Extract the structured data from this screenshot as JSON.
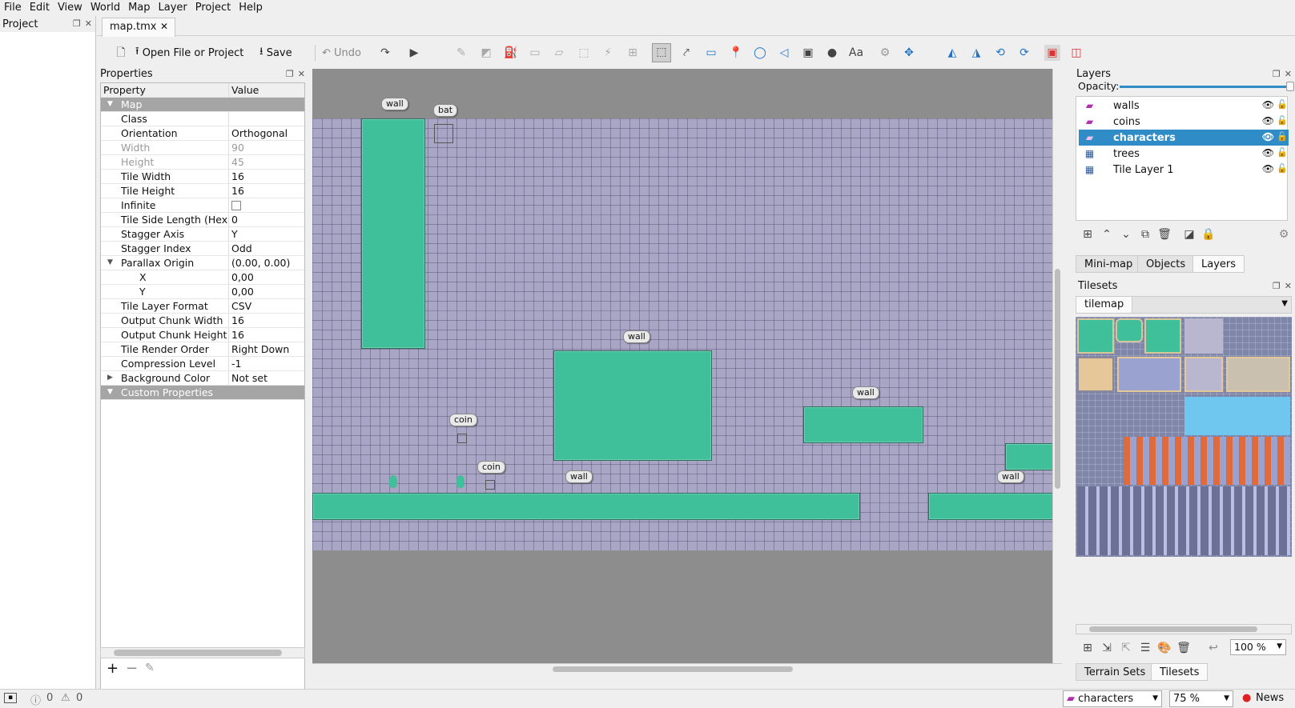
{
  "menubar": {
    "items": [
      "File",
      "Edit",
      "View",
      "World",
      "Map",
      "Layer",
      "Project",
      "Help"
    ]
  },
  "project_dock": {
    "title": "Project"
  },
  "document": {
    "tab": "map.tmx"
  },
  "toolbar": {
    "open_label": "Open File or Project",
    "save_label": "Save",
    "undo_label": "Undo"
  },
  "properties": {
    "title": "Properties",
    "col_property": "Property",
    "col_value": "Value",
    "group_map": "Map",
    "rows": [
      {
        "k": "Class",
        "v": ""
      },
      {
        "k": "Orientation",
        "v": "Orthogonal"
      },
      {
        "k": "Width",
        "v": "90"
      },
      {
        "k": "Height",
        "v": "45"
      },
      {
        "k": "Tile Width",
        "v": "16"
      },
      {
        "k": "Tile Height",
        "v": "16"
      },
      {
        "k": "Infinite",
        "v": ""
      },
      {
        "k": "Tile Side Length (Hex)",
        "v": "0"
      },
      {
        "k": "Stagger Axis",
        "v": "Y"
      },
      {
        "k": "Stagger Index",
        "v": "Odd"
      },
      {
        "k": "Parallax Origin",
        "v": "(0.00, 0.00)"
      },
      {
        "k": "X",
        "v": "0,00"
      },
      {
        "k": "Y",
        "v": "0,00"
      },
      {
        "k": "Tile Layer Format",
        "v": "CSV"
      },
      {
        "k": "Output Chunk Width",
        "v": "16"
      },
      {
        "k": "Output Chunk Height",
        "v": "16"
      },
      {
        "k": "Tile Render Order",
        "v": "Right Down"
      },
      {
        "k": "Compression Level",
        "v": "-1"
      },
      {
        "k": "Background Color",
        "v": "Not set"
      }
    ],
    "group_custom": "Custom Properties"
  },
  "map_objects": {
    "wall": "wall",
    "bat": "bat",
    "coin": "coin"
  },
  "layers": {
    "title": "Layers",
    "opacity_label": "Opacity:",
    "items": [
      {
        "name": "walls",
        "type": "object"
      },
      {
        "name": "coins",
        "type": "object"
      },
      {
        "name": "characters",
        "type": "object",
        "selected": true
      },
      {
        "name": "trees",
        "type": "tile"
      },
      {
        "name": "Tile Layer 1",
        "type": "tile"
      }
    ],
    "tabs": [
      "Mini-map",
      "Objects",
      "Layers"
    ]
  },
  "tilesets": {
    "title": "Tilesets",
    "tab": "tilemap",
    "zoom": "100 %",
    "tabs": [
      "Terrain Sets",
      "Tilesets"
    ]
  },
  "status": {
    "errors": "0",
    "warnings": "0",
    "layer": "characters",
    "zoom": "75 %",
    "news": "News"
  },
  "colors": {
    "accent": "#308cc6",
    "wall_fill": "#3fbf9a",
    "map_bg": "#a9a5c4"
  }
}
